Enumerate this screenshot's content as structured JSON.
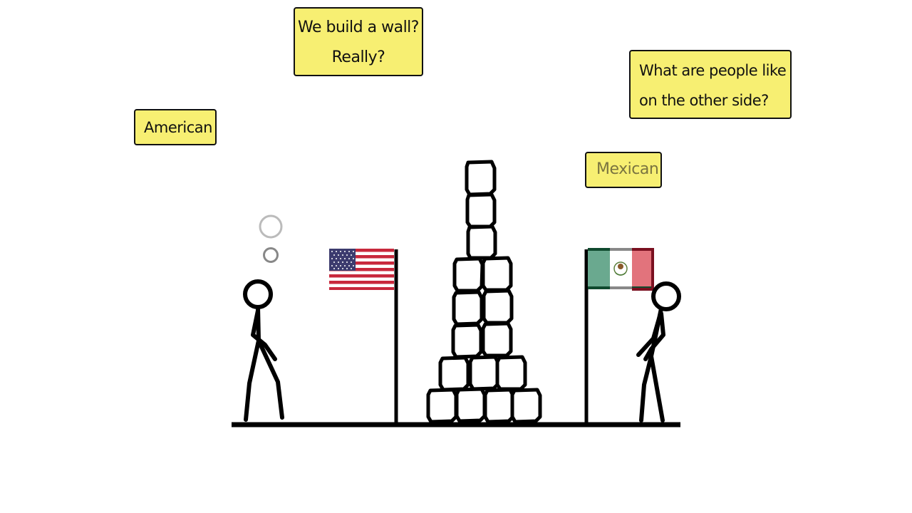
{
  "notes": {
    "wall_question": {
      "line1": "We build a wall?",
      "line2": "Really?"
    },
    "other_side_question": {
      "line1": "What are people like",
      "line2": "on the other side?"
    },
    "american_label": "American",
    "mexican_label": "Mexican"
  },
  "colors": {
    "note_background": "#f7ef72",
    "ink": "#111111",
    "us_red": "#c8283c",
    "us_blue": "#3c3b6e",
    "mx_green": "#6aa98f",
    "mx_red": "#e2737c"
  }
}
